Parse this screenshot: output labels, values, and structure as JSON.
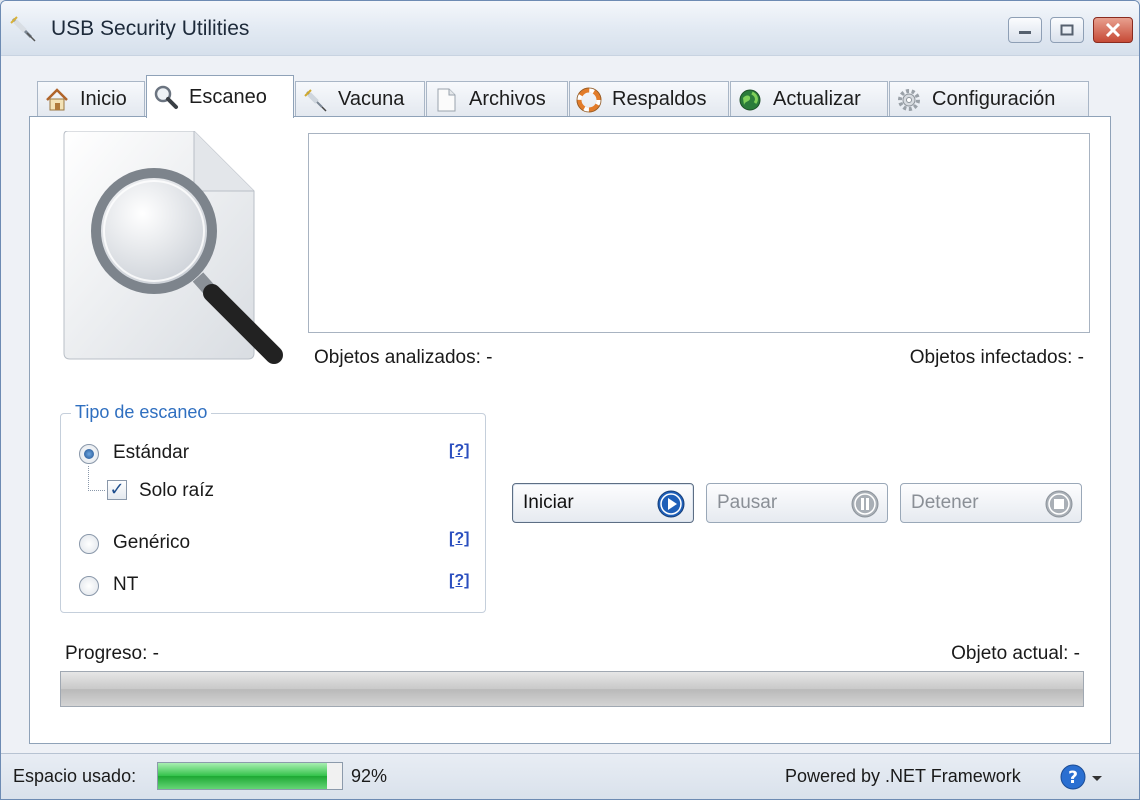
{
  "window": {
    "title": "USB Security Utilities"
  },
  "tabs": [
    {
      "label": "Inicio",
      "icon": "home-icon"
    },
    {
      "label": "Escaneo",
      "icon": "magnifier-icon",
      "active": true
    },
    {
      "label": "Vacuna",
      "icon": "syringe-icon"
    },
    {
      "label": "Archivos",
      "icon": "document-icon"
    },
    {
      "label": "Respaldos",
      "icon": "lifebuoy-icon"
    },
    {
      "label": "Actualizar",
      "icon": "globe-icon"
    },
    {
      "label": "Configuración",
      "icon": "gear-icon"
    }
  ],
  "scan": {
    "objects_analyzed": "Objetos analizados: -",
    "objects_infected": "Objetos infectados: -",
    "type_group": {
      "legend": "Tipo de escaneo",
      "standard": "Estándar",
      "root_only": "Solo raíz",
      "generic": "Genérico",
      "nt": "NT",
      "help": "[?]",
      "selected": "standard",
      "root_only_checked": true
    },
    "buttons": {
      "start": "Iniciar",
      "pause": "Pausar",
      "stop": "Detener"
    },
    "progress_label": "Progreso: -",
    "current_object": "Objeto actual: -",
    "progress": 0
  },
  "statusbar": {
    "space_label": "Espacio usado:",
    "space_percent_text": "92%",
    "space_percent": 92,
    "powered_by": "Powered by .NET Framework"
  },
  "colors": {
    "accent": "#2f6fc0",
    "space_fill": "#1ea834",
    "close_button": "#c64a36"
  }
}
